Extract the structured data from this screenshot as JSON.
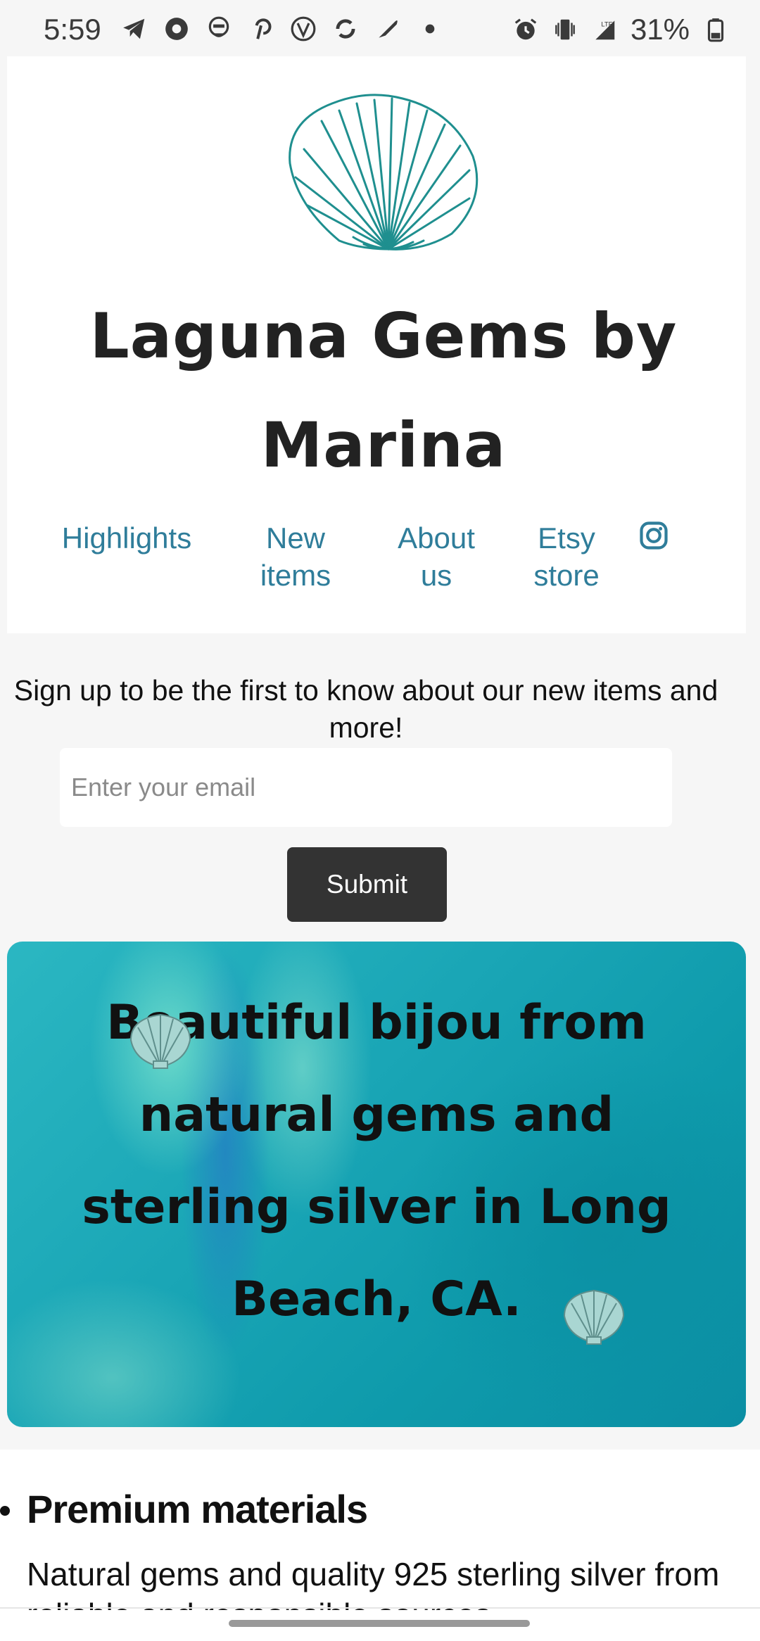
{
  "status_bar": {
    "time": "5:59",
    "battery": "31%",
    "left_icons": [
      "telegram-icon",
      "record-icon",
      "hacker-icon",
      "pinterest-icon",
      "vpn-icon",
      "sync-icon",
      "feather-icon",
      "dot-icon"
    ],
    "right_icons": [
      "alarm-icon",
      "vibrate-icon",
      "lte-signal-icon",
      "battery-icon"
    ]
  },
  "header": {
    "logo": "scallop-shell-logo",
    "title": "Laguna Gems by Marina",
    "nav": [
      {
        "label": "Highlights"
      },
      {
        "label": "New items"
      },
      {
        "label": "About us"
      },
      {
        "label": "Etsy store"
      }
    ],
    "social_icon": "instagram-icon"
  },
  "signup": {
    "text": "Sign up to be the first to know about our new items and more!",
    "email_placeholder": "Enter your email",
    "submit_label": "Submit"
  },
  "banner": {
    "text": "Beautiful bijou from natural gems and sterling silver in Long Beach, CA.",
    "decoration": "shell-emoji"
  },
  "features": {
    "items": [
      {
        "title": "Premium materials",
        "description": "Natural gems and quality 925 sterling silver from reliable and responsible sources."
      }
    ]
  },
  "colors": {
    "accent": "#2f7d9a",
    "logo": "#1f8f8f",
    "button": "#333333",
    "background": "#f6f6f6",
    "banner": "#1aa6b6"
  }
}
